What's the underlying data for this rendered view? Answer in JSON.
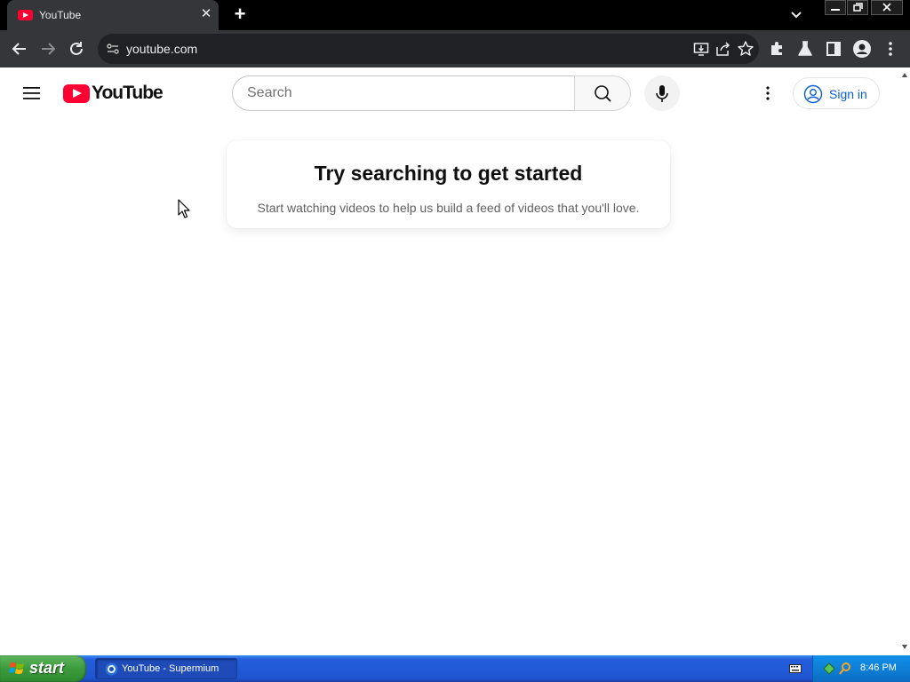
{
  "browser": {
    "tab": {
      "title": "YouTube"
    },
    "omnibox": {
      "url": "youtube.com"
    }
  },
  "youtube": {
    "logo_text": "YouTube",
    "search": {
      "placeholder": "Search",
      "value": ""
    },
    "signin_label": "Sign in",
    "nudge": {
      "title": "Try searching to get started",
      "subtitle": "Start watching videos to help us build a feed of videos that you'll love."
    },
    "brand_color": "#ff0033",
    "link_color": "#065fd4"
  },
  "taskbar": {
    "start_label": "start",
    "items": [
      {
        "label": "YouTube - Supermium"
      }
    ],
    "clock": "8:46 PM"
  },
  "icons": {
    "tab": [
      "youtube-favicon-icon",
      "close-icon",
      "plus-icon",
      "chevron-down-icon"
    ],
    "window": [
      "minimize-icon",
      "restore-icon",
      "close-icon"
    ],
    "toolbar": [
      "back-icon",
      "forward-icon",
      "reload-icon",
      "site-info-icon",
      "install-app-icon",
      "share-icon",
      "bookmark-star-icon",
      "extensions-icon",
      "labs-flask-icon",
      "side-panel-icon",
      "profile-icon",
      "kebab-menu-icon"
    ],
    "youtube": [
      "hamburger-menu-icon",
      "search-icon",
      "microphone-icon",
      "more-vert-icon",
      "account-circle-icon"
    ]
  }
}
